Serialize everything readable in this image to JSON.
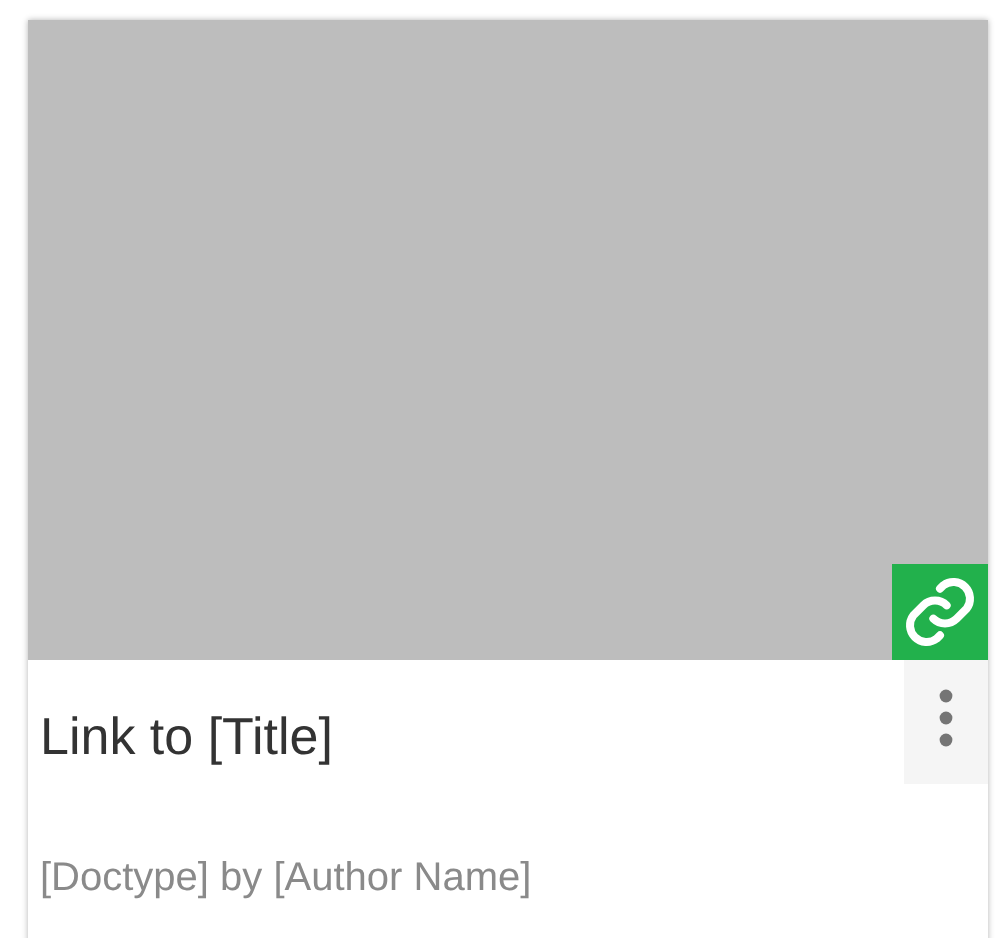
{
  "card": {
    "title": "Link to [Title]",
    "subtitle": "[Doctype] by [Author Name]"
  }
}
